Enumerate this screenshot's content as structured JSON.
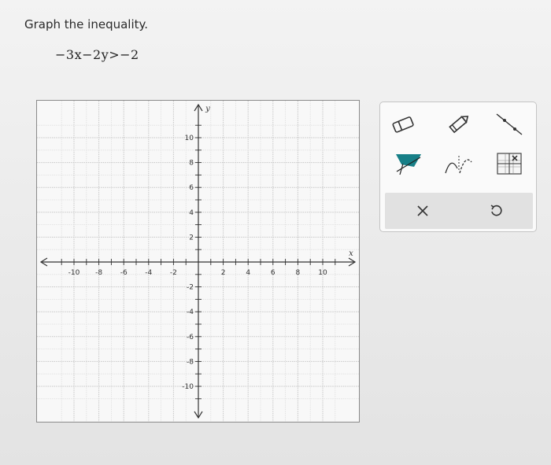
{
  "question": {
    "instruction": "Graph the inequality.",
    "inequality": "−3x−2y>−2"
  },
  "graph": {
    "x_axis_label": "x",
    "y_axis_label": "y",
    "x_range": [
      -11,
      11
    ],
    "y_range": [
      -11,
      11
    ],
    "labeled_x_ticks": [
      -10,
      -8,
      -6,
      -4,
      -2,
      2,
      4,
      6,
      8,
      10
    ],
    "labeled_y_ticks": [
      10,
      8,
      6,
      4,
      2,
      -2,
      -4,
      -6,
      -8,
      -10
    ],
    "grid_step": 1
  },
  "toolbox": {
    "tools": [
      {
        "name": "eraser",
        "icon": "eraser-icon"
      },
      {
        "name": "pencil",
        "icon": "pencil-icon"
      },
      {
        "name": "line",
        "icon": "line-tool-icon"
      },
      {
        "name": "shade-region",
        "icon": "fill-region-icon"
      },
      {
        "name": "curve",
        "icon": "curve-tool-icon"
      },
      {
        "name": "grid-point",
        "icon": "grid-point-icon"
      }
    ],
    "actions": [
      {
        "name": "clear",
        "label": "×",
        "icon": "close-icon"
      },
      {
        "name": "undo",
        "label": "↺",
        "icon": "undo-icon"
      }
    ],
    "accent_color": "#177f87"
  }
}
